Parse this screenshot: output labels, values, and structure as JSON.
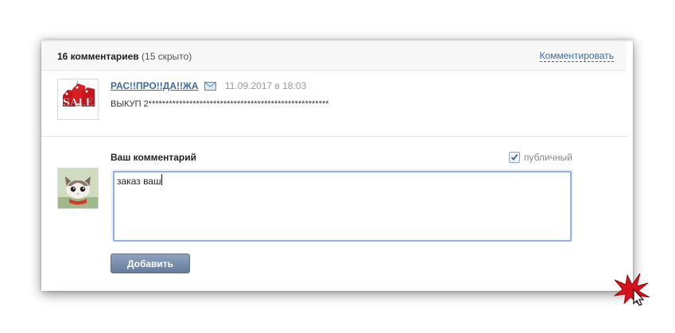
{
  "header": {
    "count_label": "16 комментариев",
    "hidden_note": "(15 скрыто)",
    "comment_link": "Комментировать"
  },
  "comment": {
    "author": "РАС!!ПРО!!ДА!!ЖА",
    "date": "11.09.2017 в 18:03",
    "text": "ВЫКУП 2*****************************************************",
    "avatar_text": "SALE",
    "avatar_icon": "sale-tags-icon"
  },
  "reply_form": {
    "label": "Ваш комментарий",
    "public_label": "публичный",
    "public_checked": true,
    "textarea_value": "заказ ваш",
    "submit_label": "Добавить",
    "avatar_icon": "kitten-icon"
  },
  "colors": {
    "link": "#3f6aa0",
    "button": "#6f86a6",
    "focus_border": "#8fb2ea"
  }
}
